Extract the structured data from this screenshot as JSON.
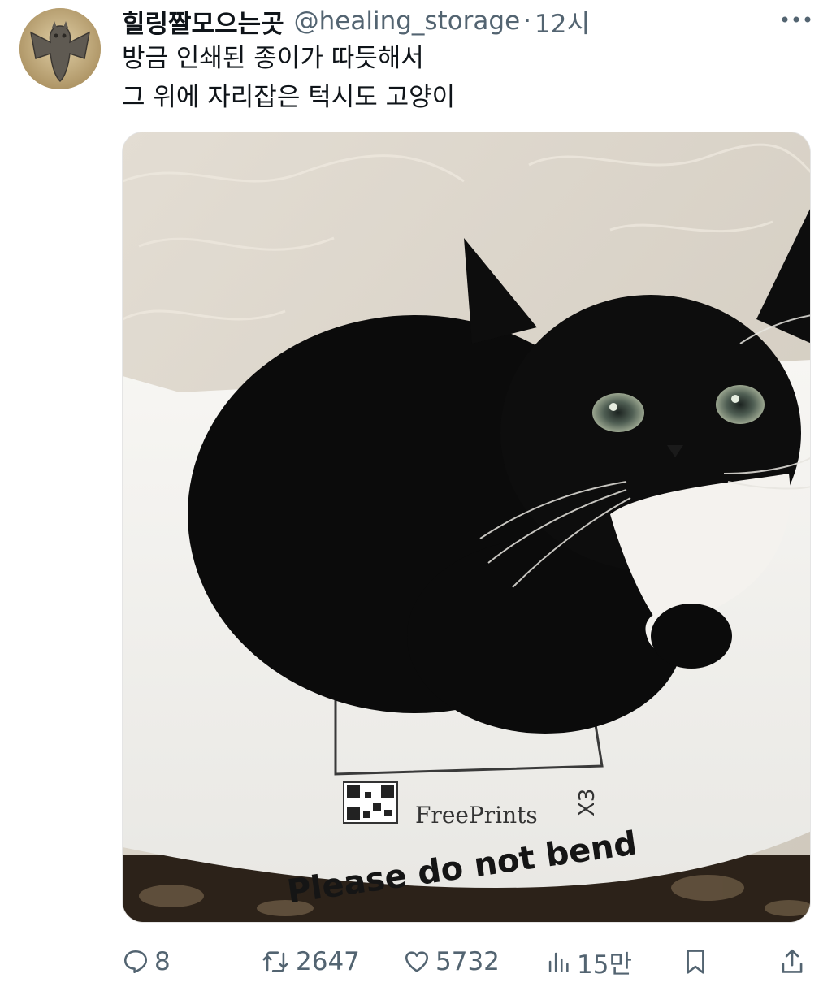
{
  "tweet": {
    "display_name": "힐링짤모으는곳",
    "handle": "@healing_storage",
    "separator": "·",
    "time": "12시",
    "text_line1": "방금 인쇄된 종이가 따듯해서",
    "text_line2": "그 위에 자리잡은 턱시도 고양이"
  },
  "media": {
    "description_icon": "tuxedo-cat-photo",
    "printed_brand": "FreePrints",
    "printed_count": "X3",
    "printed_notice": "Please do not bend"
  },
  "actions": {
    "reply_count": "8",
    "retweet_count": "2647",
    "like_count": "5732",
    "views_count": "15만"
  },
  "colors": {
    "text_primary": "#0f1419",
    "text_secondary": "#536471"
  }
}
